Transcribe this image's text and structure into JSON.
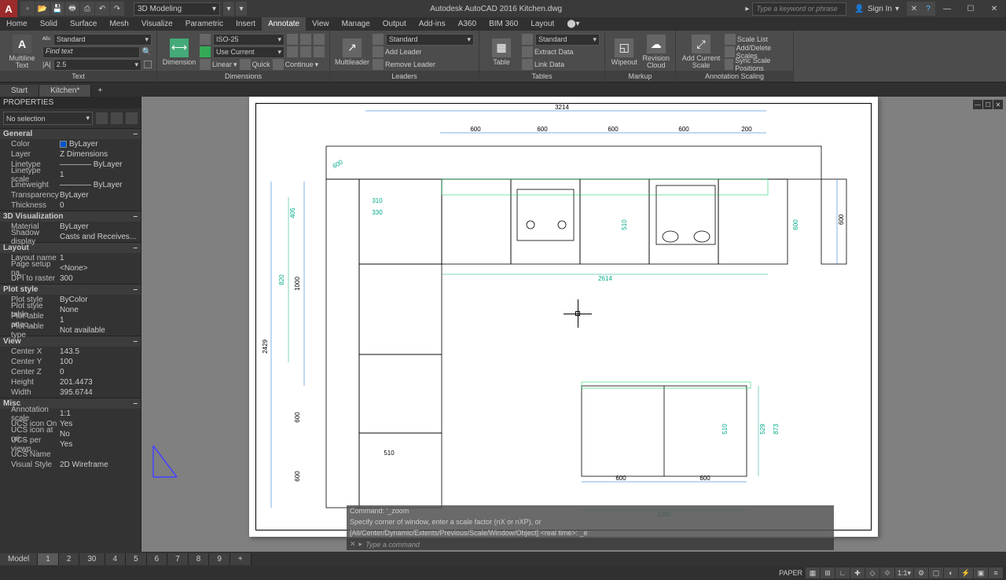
{
  "app": {
    "title": "Autodesk AutoCAD 2016   Kitchen.dwg",
    "icon": "A",
    "workspace": "3D Modeling",
    "search_placeholder": "Type a keyword or phrase",
    "signin": "Sign In"
  },
  "qat": [
    "new",
    "open",
    "save",
    "plot",
    "undo",
    "redo"
  ],
  "menu": {
    "tabs": [
      "Home",
      "Solid",
      "Surface",
      "Mesh",
      "Visualize",
      "Parametric",
      "Insert",
      "Annotate",
      "View",
      "Manage",
      "Output",
      "Add-ins",
      "A360",
      "BIM 360",
      "Layout"
    ],
    "active": "Annotate"
  },
  "ribbon": {
    "text": {
      "label": "Text",
      "big": "Multiline Text",
      "style": "Standard",
      "find": "Find text",
      "height": "2.5"
    },
    "dim": {
      "label": "Dimensions",
      "big": "Dimension",
      "style": "ISO-25",
      "layer": "Use Current",
      "btns": [
        "Linear",
        "Quick",
        "Continue"
      ]
    },
    "mleader": {
      "label": "Leaders",
      "big": "Multileader",
      "style": "Standard",
      "btns": [
        "Add Leader",
        "Remove Leader"
      ]
    },
    "table": {
      "label": "Tables",
      "big": "Table",
      "style": "Standard",
      "btns": [
        "Extract Data",
        "Link Data"
      ]
    },
    "markup": {
      "label": "Markup",
      "btns": [
        "Wipeout",
        "Revision Cloud"
      ]
    },
    "scale": {
      "label": "Annotation Scaling",
      "big": "Add Current Scale",
      "btns": [
        "Scale List",
        "Add/Delete Scales",
        "Sync Scale Positions"
      ]
    }
  },
  "filetabs": {
    "tabs": [
      "Start",
      "Kitchen*"
    ],
    "active": "Kitchen*"
  },
  "props": {
    "title": "PROPERTIES",
    "selection": "No selection",
    "cats": [
      {
        "name": "General",
        "rows": [
          [
            "Color",
            "ByLayer",
            "swatch"
          ],
          [
            "Layer",
            "Z Dimensions"
          ],
          [
            "Linetype",
            "———— ByLayer"
          ],
          [
            "Linetype scale",
            "1"
          ],
          [
            "Lineweight",
            "———— ByLayer"
          ],
          [
            "Transparency",
            "ByLayer"
          ],
          [
            "Thickness",
            "0"
          ]
        ]
      },
      {
        "name": "3D Visualization",
        "rows": [
          [
            "Material",
            "ByLayer"
          ],
          [
            "Shadow display",
            "Casts and Receives..."
          ]
        ]
      },
      {
        "name": "Layout",
        "rows": [
          [
            "Layout name",
            "1"
          ],
          [
            "Page setup na...",
            "<None>"
          ],
          [
            "DPI to raster",
            "300"
          ]
        ]
      },
      {
        "name": "Plot style",
        "rows": [
          [
            "Plot style",
            "ByColor"
          ],
          [
            "Plot style table",
            "None"
          ],
          [
            "Plot table attac...",
            "1"
          ],
          [
            "Plot table type",
            "Not available"
          ]
        ]
      },
      {
        "name": "View",
        "rows": [
          [
            "Center X",
            "143.5"
          ],
          [
            "Center Y",
            "100"
          ],
          [
            "Center Z",
            "0"
          ],
          [
            "Height",
            "201.4473"
          ],
          [
            "Width",
            "395.6744"
          ]
        ]
      },
      {
        "name": "Misc",
        "rows": [
          [
            "Annotation scale",
            "1:1"
          ],
          [
            "UCS icon On",
            "Yes"
          ],
          [
            "UCS icon at ori...",
            "No"
          ],
          [
            "UCS per viewp...",
            "Yes"
          ],
          [
            "UCS Name",
            ""
          ],
          [
            "Visual Style",
            "2D Wireframe"
          ]
        ]
      }
    ]
  },
  "dims": {
    "top_main": "3214",
    "top_sub": [
      "600",
      "600",
      "600",
      "600",
      "200"
    ],
    "right": "600",
    "left_main": "2429",
    "left_1000": "1000",
    "left_820": "820",
    "left_405": "405",
    "left_600a": "600",
    "left_600b": "600",
    "cab_310": "310",
    "cab_330": "330",
    "bot_2614": "2614",
    "sink_510": "510",
    "island_w": [
      "600",
      "600"
    ],
    "island_1200": "1200",
    "island_510": "510",
    "island_529": "529",
    "island_873": "873",
    "plan_510": "510",
    "cab_600": "600",
    "cab_600b": "600"
  },
  "cmd": {
    "h1": "Command: '_zoom",
    "h2": "Specify corner of window, enter a scale factor (nX or nXP), or",
    "h3": "[All/Center/Dynamic/Extents/Previous/Scale/Window/Object] <real time>: _e",
    "prompt": "Type a command"
  },
  "layouttabs": {
    "tabs": [
      "Model",
      "1",
      "2",
      "30",
      "4",
      "5",
      "6",
      "7",
      "8",
      "9",
      "+"
    ],
    "active": "1"
  },
  "status": {
    "label": "PAPER"
  }
}
